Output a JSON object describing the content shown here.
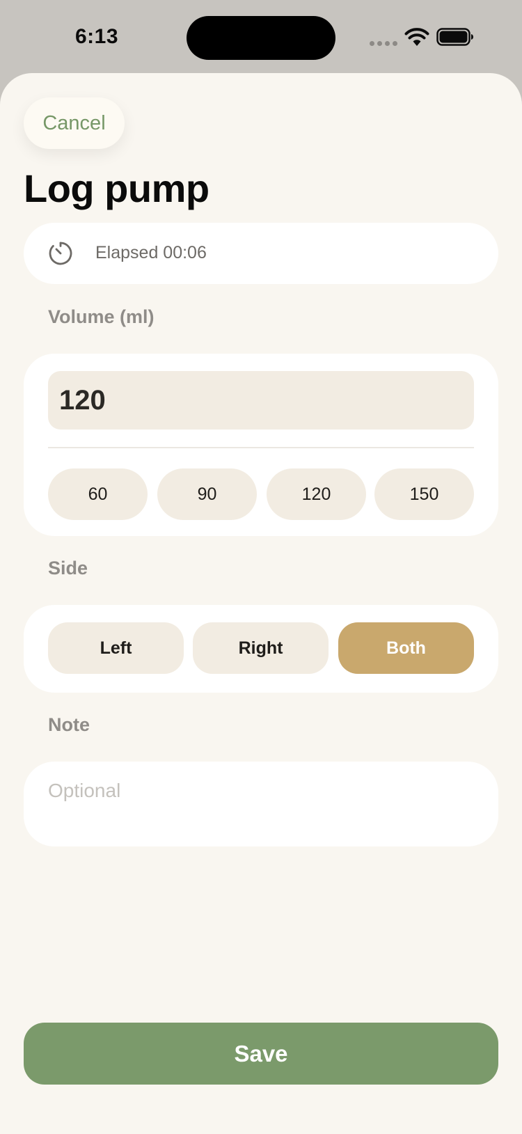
{
  "status_bar": {
    "time": "6:13"
  },
  "header": {
    "cancel_label": "Cancel",
    "title": "Log pump"
  },
  "timer": {
    "elapsed_text": "Elapsed 00:06"
  },
  "volume": {
    "label": "Volume (ml)",
    "value": "120",
    "presets": [
      "60",
      "90",
      "120",
      "150"
    ]
  },
  "side": {
    "label": "Side",
    "options": [
      "Left",
      "Right",
      "Both"
    ],
    "selected": "Both"
  },
  "note": {
    "label": "Note",
    "placeholder": "Optional"
  },
  "footer": {
    "save_label": "Save"
  },
  "colors": {
    "accent_green": "#7b9a6b",
    "selected_gold": "#c9a86d",
    "sheet_background": "#f9f6f0",
    "chip_background": "#f2ece2"
  }
}
